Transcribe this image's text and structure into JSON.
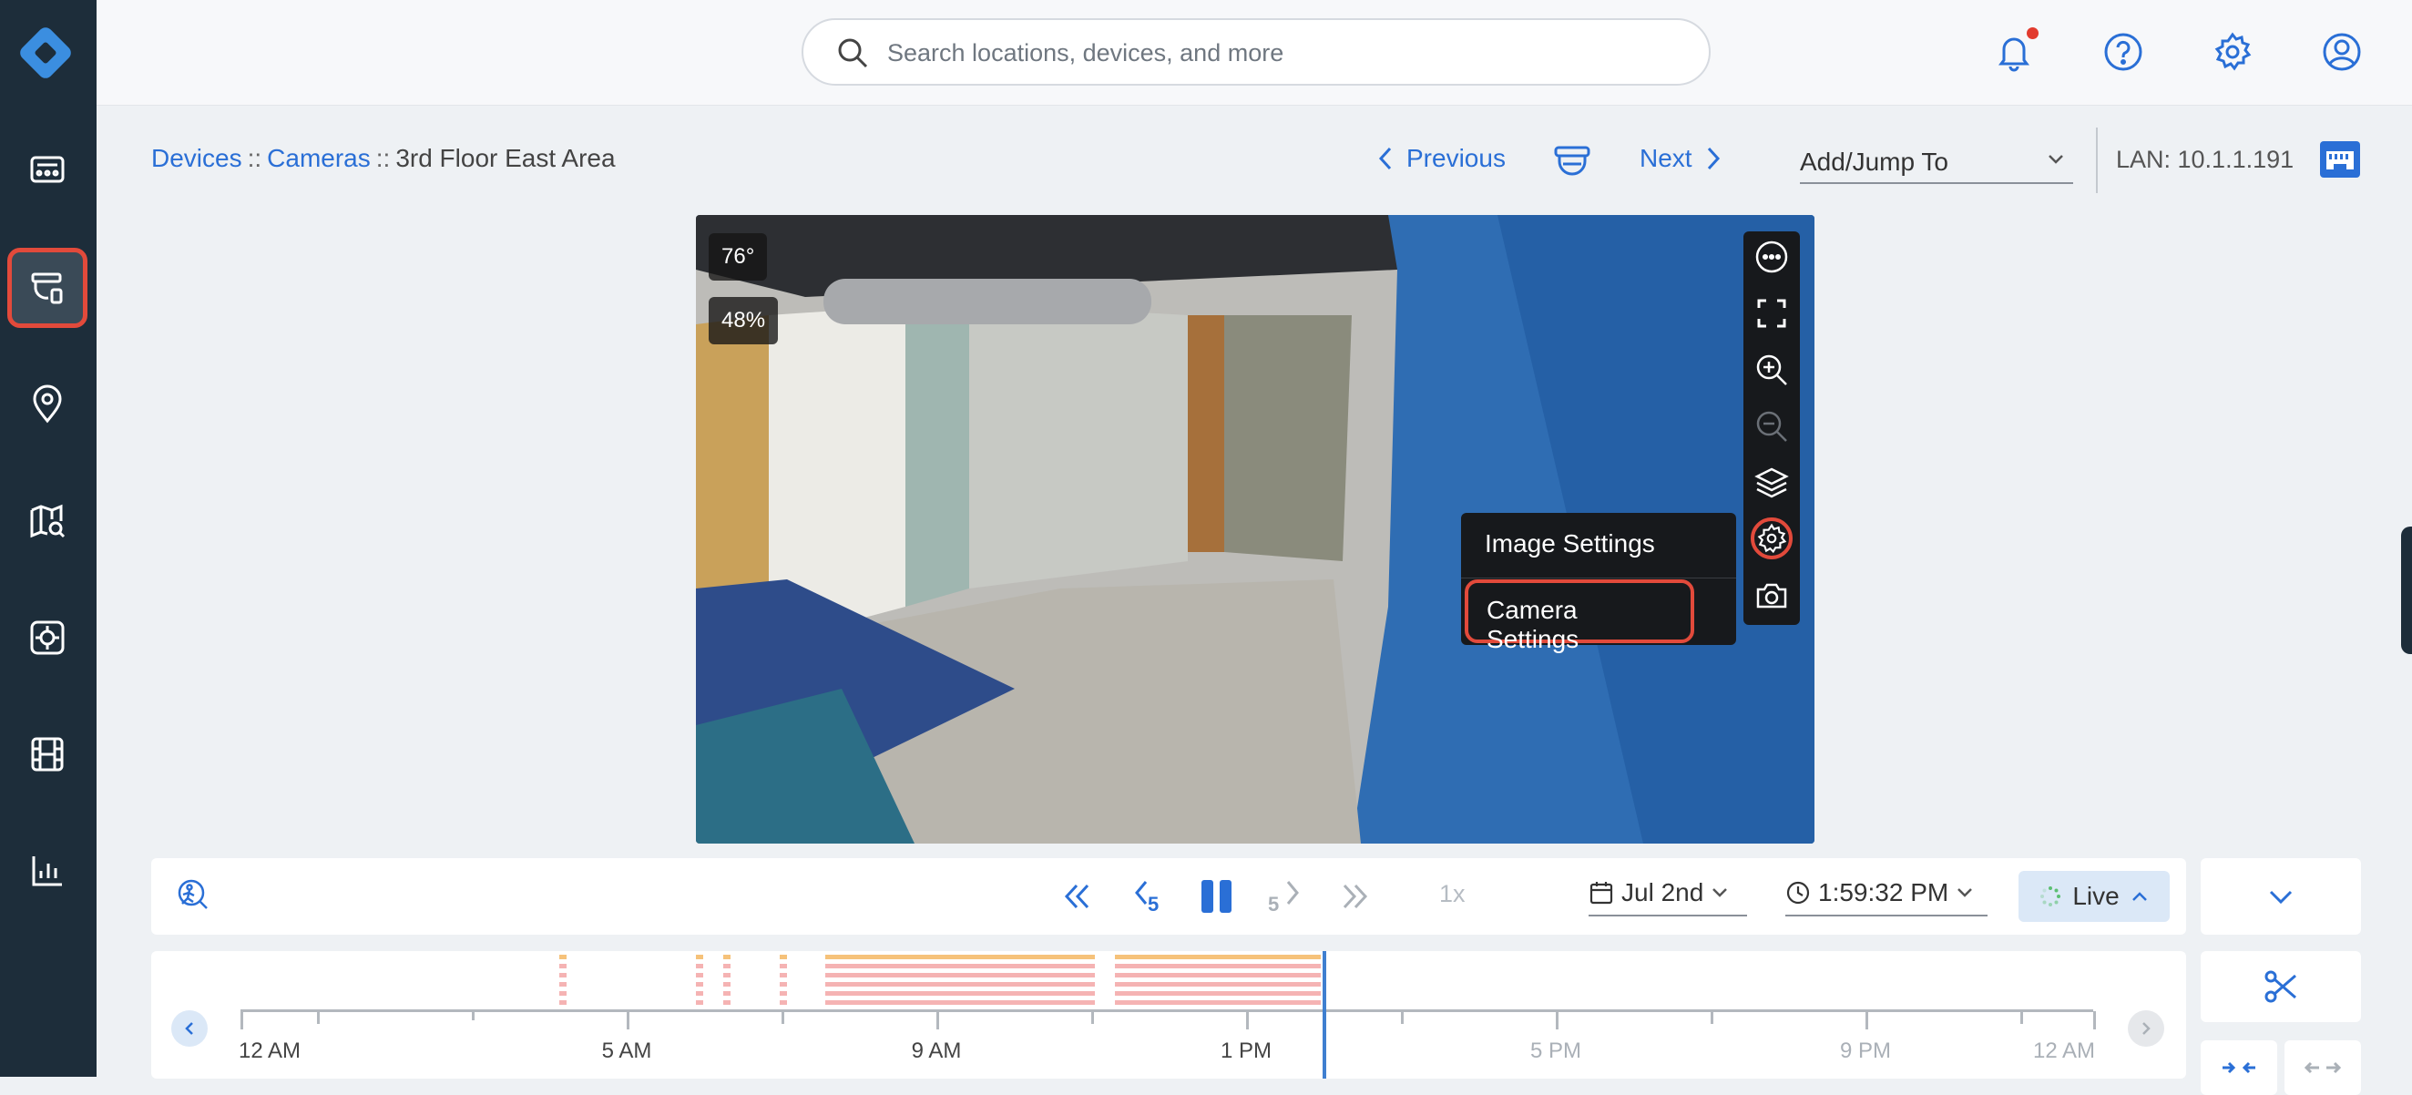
{
  "search": {
    "placeholder": "Search locations, devices, and more"
  },
  "breadcrumb": {
    "devices": "Devices",
    "sep": "::",
    "cameras": "Cameras",
    "current": "3rd Floor East Area"
  },
  "nav": {
    "previous": "Previous",
    "next": "Next",
    "jump": "Add/Jump To",
    "lan": "LAN: 10.1.1.191"
  },
  "video": {
    "temperature": "76°",
    "humidity": "48%",
    "menu": {
      "image_settings": "Image Settings",
      "camera_settings": "Camera Settings"
    }
  },
  "playback": {
    "speed": "1x",
    "date": "Jul 2nd",
    "time": "1:59:32 PM",
    "live": "Live",
    "skip_back": "5",
    "skip_fwd": "5"
  },
  "timeline": {
    "labels": [
      "12 AM",
      "5 AM",
      "9 AM",
      "1 PM",
      "5 PM",
      "9 PM",
      "12 AM"
    ]
  },
  "colors": {
    "accent": "#2a6fd6",
    "highlight": "#e24a3b",
    "sidebar": "#1d2d3a"
  }
}
